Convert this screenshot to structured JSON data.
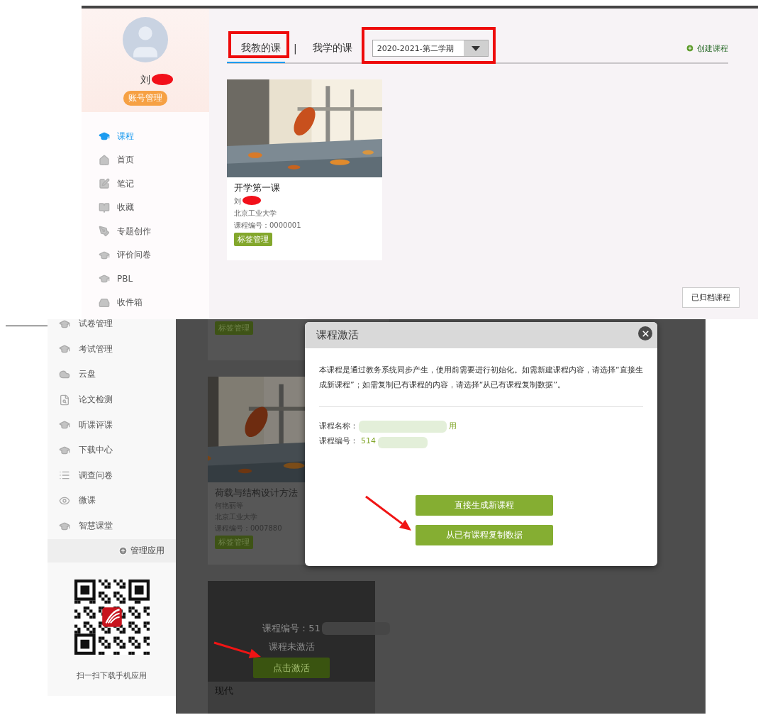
{
  "top_panel": {
    "profile": {
      "name": "刘",
      "account_button": "账号管理"
    },
    "nav": [
      {
        "label": "课程",
        "selected": true
      },
      {
        "label": "首页",
        "selected": false
      },
      {
        "label": "笔记",
        "selected": false
      },
      {
        "label": "收藏",
        "selected": false
      },
      {
        "label": "专题创作",
        "selected": false
      },
      {
        "label": "评价问卷",
        "selected": false
      },
      {
        "label": "PBL",
        "selected": false
      },
      {
        "label": "收件箱",
        "selected": false
      }
    ],
    "tabs": [
      {
        "label": "我教的课",
        "selected": true
      },
      {
        "label": "我学的课",
        "selected": false
      }
    ],
    "tab_separator": "|",
    "term_select": {
      "value": "2020-2021-第二学期"
    },
    "create_course": "创建课程",
    "courses": [
      {
        "title": "开学第一课",
        "teacher": "刘",
        "school": "北京工业大学",
        "code": "课程编号：0000001",
        "tag_button": "标签管理"
      }
    ],
    "archived_button": "已归档课程"
  },
  "bottom_panel": {
    "nav": [
      "试卷管理",
      "考试管理",
      "云盘",
      "论文检测",
      "听课评课",
      "下载中心",
      "调查问卷",
      "微课",
      "智慧课堂"
    ],
    "manage_apps": "管理应用",
    "qr_caption": "扫一扫下载手机应用",
    "courses": [
      {
        "kind": "partial",
        "tag_button": "标签管理"
      },
      {
        "kind": "card",
        "title": "荷载与结构设计方法",
        "teacher": "何艳丽等",
        "school": "北京工业大学",
        "code": "课程编号：0007880",
        "tag_button": "标签管理"
      },
      {
        "kind": "inactive",
        "code": "课程编号：51",
        "status": "课程未激活",
        "activate_button": "点击激活",
        "title": "现代"
      }
    ],
    "dialog": {
      "title": "课程激活",
      "message": "本课程是通过教务系统同步产生，使用前需要进行初始化。如需新建课程内容，请选择“直接生成新课程”；如需复制已有课程的内容，请选择“从已有课程复制数据”。",
      "fields": [
        {
          "label": "课程名称：",
          "value": "用"
        },
        {
          "label": "课程编号：",
          "value": "514"
        }
      ],
      "buttons": [
        "直接生成新课程",
        "从已有课程复制数据"
      ]
    }
  }
}
